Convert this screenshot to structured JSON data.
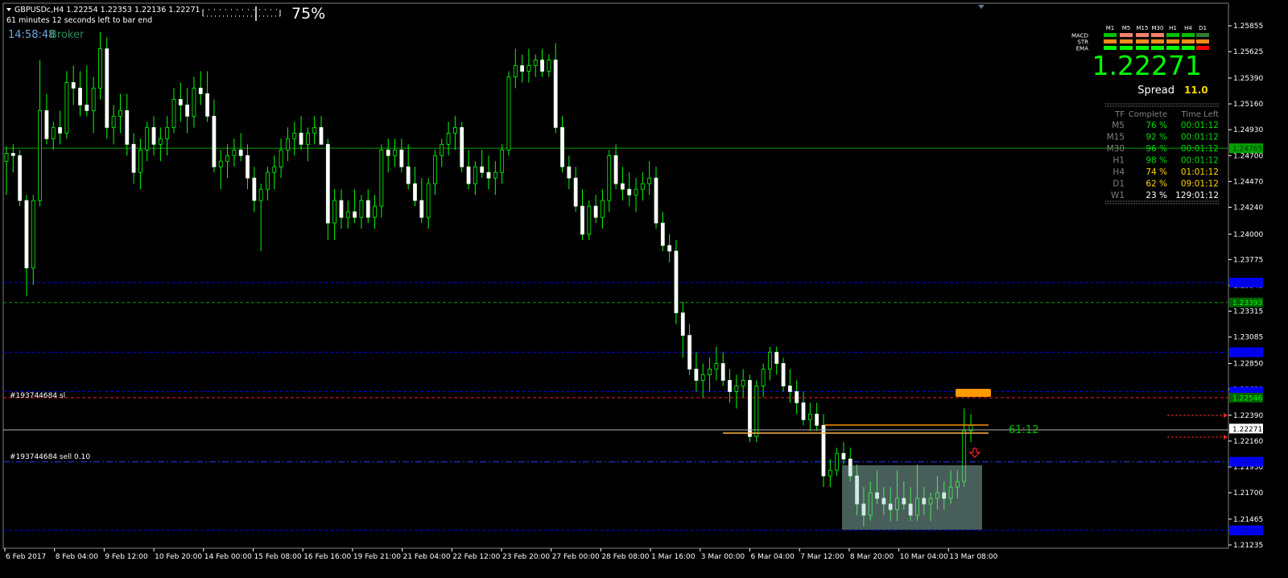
{
  "header": {
    "symbol_line": "GBPUSDc,H4  1.22254 1.22353 1.22136 1.22271",
    "timer_line": "61 minutes 12 seconds left to bar end",
    "clock": "14:58:48",
    "clock_suffix": "Broker",
    "progress_text": "75%"
  },
  "signal_panel": {
    "timeframes": [
      "M1",
      "M5",
      "M15",
      "M30",
      "H1",
      "H4",
      "D1"
    ],
    "rows": [
      {
        "label": "MACD",
        "colors": [
          "#00c000",
          "#f08070",
          "#f08070",
          "#f08070",
          "#00c000",
          "#00c000",
          "#2e7d32"
        ]
      },
      {
        "label": "STR",
        "colors": [
          "#ff8c1a",
          "#ff8c1a",
          "#ff8c1a",
          "#ff8c1a",
          "#ff8c1a",
          "#ff8c1a",
          "#ff8c1a"
        ]
      },
      {
        "label": "EMA",
        "colors": [
          "#00ff00",
          "#00ff00",
          "#00ff00",
          "#00ff00",
          "#00ff00",
          "#00ff00",
          "#ff0000"
        ]
      }
    ],
    "price": "1.22271",
    "spread_label": "Spread",
    "spread_value": "11.0"
  },
  "tf_table": {
    "headers": [
      "TF",
      "Complete",
      "Time Left"
    ],
    "rows": [
      {
        "tf": "M5",
        "complete": "76 %",
        "left": "00:01:12",
        "color": "#00dd00"
      },
      {
        "tf": "M15",
        "complete": "92 %",
        "left": "00:01:12",
        "color": "#00dd00"
      },
      {
        "tf": "M30",
        "complete": "96 %",
        "left": "00:01:12",
        "color": "#00dd00"
      },
      {
        "tf": "H1",
        "complete": "98 %",
        "left": "00:01:12",
        "color": "#00dd00"
      },
      {
        "tf": "H4",
        "complete": "74 %",
        "left": "01:01:12",
        "color": "#ffd700"
      },
      {
        "tf": "D1",
        "complete": "62 %",
        "left": "09:01:12",
        "color": "#ffd700"
      },
      {
        "tf": "W1",
        "complete": "23 %",
        "left": "129:01:12",
        "color": "#ffffff"
      }
    ]
  },
  "price_axis": {
    "labels": [
      "1.25855",
      "1.25625",
      "1.25390",
      "1.25160",
      "1.24930",
      "1.24700",
      "1.24470",
      "1.24240",
      "1.24000",
      "1.23775",
      "1.23545",
      "1.23315",
      "1.23085",
      "1.22850",
      "1.22620",
      "1.22390",
      "1.22160",
      "1.21930",
      "1.21700",
      "1.21465",
      "1.21235"
    ],
    "y_top": 1.25855,
    "y_bottom": 1.21235,
    "tags": [
      {
        "value": "1.24765",
        "price": 1.24765,
        "bg": "#00a000",
        "fg": "#003000"
      },
      {
        "value": "1.23570",
        "price": 1.2357,
        "bg": "#0000ff",
        "fg": "#0000aa"
      },
      {
        "value": "1.23393",
        "price": 1.23393,
        "bg": "#006000",
        "fg": "#00ff00"
      },
      {
        "value": "1.22950",
        "price": 1.2295,
        "bg": "#0000ff",
        "fg": "#0000aa"
      },
      {
        "value": "1.22600",
        "price": 1.226,
        "bg": "#0000ff",
        "fg": "#0000aa"
      },
      {
        "value": "1.22546",
        "price": 1.22546,
        "bg": "#006000",
        "fg": "#00ff00"
      },
      {
        "value": "1.22271",
        "price": 1.22271,
        "bg": "#ffffff",
        "fg": "#000000"
      },
      {
        "value": "1.21975",
        "price": 1.21975,
        "bg": "#0000ff",
        "fg": "#0000aa"
      },
      {
        "value": "1.21365",
        "price": 1.21365,
        "bg": "#0000ff",
        "fg": "#0000aa"
      }
    ]
  },
  "time_axis": {
    "labels": [
      "6 Feb 2017",
      "8 Feb 04:00",
      "9 Feb 12:00",
      "10 Feb 20:00",
      "14 Feb 00:00",
      "15 Feb 08:00",
      "16 Feb 16:00",
      "19 Feb 21:00",
      "21 Feb 04:00",
      "22 Feb 12:00",
      "23 Feb 20:00",
      "27 Feb 00:00",
      "28 Feb 08:00",
      "1 Mar 16:00",
      "3 Mar 00:00",
      "6 Mar 04:00",
      "7 Mar 12:00",
      "8 Mar 20:00",
      "10 Mar 04:00",
      "13 Mar 08:00"
    ]
  },
  "orders": {
    "sl_label": "#193744684 sl",
    "sell_label": "#193744684 sell 0.10",
    "countdown": "61:12"
  },
  "chart_data": {
    "type": "candlestick",
    "symbol": "GBPUSDc",
    "timeframe": "H4",
    "ylim": [
      1.21235,
      1.25855
    ],
    "current_price": 1.22271,
    "bid": 1.22271,
    "ask": 1.22382,
    "levels": [
      {
        "price": 1.24765,
        "style": "solid",
        "color": "#00a000"
      },
      {
        "price": 1.2357,
        "style": "dashed",
        "color": "#0000ff"
      },
      {
        "price": 1.23393,
        "style": "dashed",
        "color": "#00a000"
      },
      {
        "price": 1.2295,
        "style": "dashed",
        "color": "#0000ff"
      },
      {
        "price": 1.226,
        "style": "dashed",
        "color": "#0000ff"
      },
      {
        "price": 1.22546,
        "style": "dashed",
        "color": "#ff2020"
      },
      {
        "price": 1.21975,
        "style": "dashdot",
        "color": "#2040ff"
      },
      {
        "price": 1.21365,
        "style": "dashed",
        "color": "#0000ff"
      }
    ],
    "candles": [
      [
        1.2465,
        1.2478,
        1.2435,
        1.2472
      ],
      [
        1.2472,
        1.248,
        1.2455,
        1.247
      ],
      [
        1.247,
        1.2475,
        1.2425,
        1.243
      ],
      [
        1.243,
        1.2435,
        1.2345,
        1.237
      ],
      [
        1.237,
        1.2435,
        1.2355,
        1.243
      ],
      [
        1.243,
        1.2555,
        1.2425,
        1.251
      ],
      [
        1.251,
        1.2525,
        1.248,
        1.2485
      ],
      [
        1.2485,
        1.25,
        1.2475,
        1.2495
      ],
      [
        1.2495,
        1.251,
        1.248,
        1.249
      ],
      [
        1.249,
        1.2545,
        1.2485,
        1.2535
      ],
      [
        1.2535,
        1.255,
        1.2515,
        1.253
      ],
      [
        1.253,
        1.2545,
        1.2505,
        1.2515
      ],
      [
        1.2515,
        1.255,
        1.2505,
        1.251
      ],
      [
        1.251,
        1.254,
        1.249,
        1.253
      ],
      [
        1.253,
        1.258,
        1.252,
        1.2565
      ],
      [
        1.2565,
        1.2575,
        1.2485,
        1.2495
      ],
      [
        1.2495,
        1.2515,
        1.248,
        1.2505
      ],
      [
        1.2505,
        1.2525,
        1.249,
        1.251
      ],
      [
        1.251,
        1.2525,
        1.247,
        1.248
      ],
      [
        1.248,
        1.249,
        1.2445,
        1.2455
      ],
      [
        1.2455,
        1.2485,
        1.244,
        1.2475
      ],
      [
        1.2475,
        1.25,
        1.2465,
        1.2495
      ],
      [
        1.2495,
        1.2505,
        1.247,
        1.248
      ],
      [
        1.248,
        1.2495,
        1.2465,
        1.2485
      ],
      [
        1.2485,
        1.2505,
        1.247,
        1.2495
      ],
      [
        1.2495,
        1.253,
        1.249,
        1.252
      ],
      [
        1.252,
        1.2535,
        1.25,
        1.2515
      ],
      [
        1.2515,
        1.253,
        1.249,
        1.2505
      ],
      [
        1.2505,
        1.254,
        1.2495,
        1.253
      ],
      [
        1.253,
        1.2545,
        1.2515,
        1.2525
      ],
      [
        1.2525,
        1.2545,
        1.25,
        1.2505
      ],
      [
        1.2505,
        1.252,
        1.2455,
        1.246
      ],
      [
        1.246,
        1.2475,
        1.244,
        1.2465
      ],
      [
        1.2465,
        1.248,
        1.245,
        1.247
      ],
      [
        1.247,
        1.2485,
        1.246,
        1.2475
      ],
      [
        1.2475,
        1.249,
        1.2465,
        1.247
      ],
      [
        1.247,
        1.248,
        1.244,
        1.245
      ],
      [
        1.245,
        1.246,
        1.242,
        1.243
      ],
      [
        1.243,
        1.2445,
        1.2385,
        1.244
      ],
      [
        1.244,
        1.246,
        1.243,
        1.2455
      ],
      [
        1.2455,
        1.247,
        1.244,
        1.246
      ],
      [
        1.246,
        1.2485,
        1.245,
        1.2475
      ],
      [
        1.2475,
        1.2495,
        1.2465,
        1.2485
      ],
      [
        1.2485,
        1.25,
        1.247,
        1.249
      ],
      [
        1.249,
        1.2505,
        1.2475,
        1.248
      ],
      [
        1.248,
        1.2495,
        1.2465,
        1.249
      ],
      [
        1.249,
        1.2505,
        1.248,
        1.2495
      ],
      [
        1.2495,
        1.2505,
        1.248,
        1.248
      ],
      [
        1.248,
        1.2485,
        1.2395,
        1.241
      ],
      [
        1.241,
        1.244,
        1.2395,
        1.243
      ],
      [
        1.243,
        1.244,
        1.2405,
        1.2415
      ],
      [
        1.2415,
        1.243,
        1.2405,
        1.242
      ],
      [
        1.242,
        1.244,
        1.241,
        1.2415
      ],
      [
        1.2415,
        1.2435,
        1.2405,
        1.243
      ],
      [
        1.243,
        1.244,
        1.241,
        1.2415
      ],
      [
        1.2415,
        1.2435,
        1.2405,
        1.2425
      ],
      [
        1.2425,
        1.248,
        1.2415,
        1.2475
      ],
      [
        1.2475,
        1.2485,
        1.2455,
        1.247
      ],
      [
        1.247,
        1.2485,
        1.246,
        1.2475
      ],
      [
        1.2475,
        1.2485,
        1.2455,
        1.246
      ],
      [
        1.246,
        1.248,
        1.244,
        1.2445
      ],
      [
        1.2445,
        1.246,
        1.2425,
        1.243
      ],
      [
        1.243,
        1.245,
        1.241,
        1.2415
      ],
      [
        1.2415,
        1.245,
        1.2405,
        1.2445
      ],
      [
        1.2445,
        1.2475,
        1.2435,
        1.247
      ],
      [
        1.247,
        1.2485,
        1.246,
        1.248
      ],
      [
        1.248,
        1.25,
        1.247,
        1.249
      ],
      [
        1.249,
        1.2505,
        1.2475,
        1.2495
      ],
      [
        1.2495,
        1.25,
        1.2455,
        1.246
      ],
      [
        1.246,
        1.2475,
        1.244,
        1.2445
      ],
      [
        1.2445,
        1.2465,
        1.2435,
        1.246
      ],
      [
        1.246,
        1.2475,
        1.245,
        1.2455
      ],
      [
        1.2455,
        1.247,
        1.244,
        1.245
      ],
      [
        1.245,
        1.2465,
        1.2435,
        1.2455
      ],
      [
        1.2455,
        1.248,
        1.2445,
        1.2475
      ],
      [
        1.2475,
        1.2545,
        1.247,
        1.254
      ],
      [
        1.254,
        1.2565,
        1.253,
        1.255
      ],
      [
        1.255,
        1.256,
        1.2535,
        1.2545
      ],
      [
        1.2545,
        1.2565,
        1.2535,
        1.255
      ],
      [
        1.255,
        1.256,
        1.254,
        1.2555
      ],
      [
        1.2555,
        1.2565,
        1.254,
        1.2545
      ],
      [
        1.2545,
        1.256,
        1.254,
        1.2555
      ],
      [
        1.2555,
        1.257,
        1.249,
        1.2495
      ],
      [
        1.2495,
        1.2505,
        1.2455,
        1.246
      ],
      [
        1.246,
        1.247,
        1.244,
        1.245
      ],
      [
        1.245,
        1.246,
        1.242,
        1.2425
      ],
      [
        1.2425,
        1.244,
        1.2395,
        1.24
      ],
      [
        1.24,
        1.243,
        1.2395,
        1.2425
      ],
      [
        1.2425,
        1.2435,
        1.241,
        1.2415
      ],
      [
        1.2415,
        1.244,
        1.2405,
        1.243
      ],
      [
        1.243,
        1.2475,
        1.242,
        1.247
      ],
      [
        1.247,
        1.248,
        1.244,
        1.2445
      ],
      [
        1.2445,
        1.246,
        1.243,
        1.244
      ],
      [
        1.244,
        1.2455,
        1.2425,
        1.2435
      ],
      [
        1.2435,
        1.245,
        1.242,
        1.244
      ],
      [
        1.244,
        1.2455,
        1.243,
        1.2445
      ],
      [
        1.2445,
        1.2465,
        1.2435,
        1.245
      ],
      [
        1.245,
        1.246,
        1.2405,
        1.241
      ],
      [
        1.241,
        1.242,
        1.2385,
        1.239
      ],
      [
        1.239,
        1.24,
        1.2375,
        1.2385
      ],
      [
        1.2385,
        1.2395,
        1.232,
        1.233
      ],
      [
        1.233,
        1.234,
        1.229,
        1.231
      ],
      [
        1.231,
        1.232,
        1.2275,
        1.228
      ],
      [
        1.228,
        1.2295,
        1.226,
        1.227
      ],
      [
        1.227,
        1.2285,
        1.2255,
        1.2275
      ],
      [
        1.2275,
        1.229,
        1.226,
        1.228
      ],
      [
        1.228,
        1.23,
        1.227,
        1.2285
      ],
      [
        1.2285,
        1.2295,
        1.2265,
        1.227
      ],
      [
        1.227,
        1.228,
        1.225,
        1.226
      ],
      [
        1.226,
        1.2275,
        1.2245,
        1.2265
      ],
      [
        1.2265,
        1.228,
        1.2255,
        1.227
      ],
      [
        1.227,
        1.2275,
        1.2215,
        1.222
      ],
      [
        1.222,
        1.227,
        1.2215,
        1.2265
      ],
      [
        1.2265,
        1.2285,
        1.2255,
        1.228
      ],
      [
        1.228,
        1.23,
        1.227,
        1.2295
      ],
      [
        1.2295,
        1.23,
        1.2275,
        1.2285
      ],
      [
        1.2285,
        1.229,
        1.226,
        1.2265
      ],
      [
        1.2265,
        1.228,
        1.225,
        1.226
      ],
      [
        1.226,
        1.227,
        1.224,
        1.225
      ],
      [
        1.225,
        1.226,
        1.223,
        1.2235
      ],
      [
        1.2235,
        1.225,
        1.2225,
        1.224
      ],
      [
        1.224,
        1.225,
        1.2225,
        1.223
      ],
      [
        1.223,
        1.224,
        1.2175,
        1.2185
      ],
      [
        1.2185,
        1.22,
        1.2175,
        1.219
      ],
      [
        1.219,
        1.221,
        1.2185,
        1.2205
      ],
      [
        1.2205,
        1.2215,
        1.2195,
        1.22
      ],
      [
        1.22,
        1.221,
        1.218,
        1.2185
      ],
      [
        1.2185,
        1.2195,
        1.215,
        1.216
      ],
      [
        1.216,
        1.2175,
        1.214,
        1.215
      ],
      [
        1.215,
        1.218,
        1.2145,
        1.217
      ],
      [
        1.217,
        1.219,
        1.216,
        1.2165
      ],
      [
        1.2165,
        1.2175,
        1.215,
        1.216
      ],
      [
        1.216,
        1.2175,
        1.2145,
        1.2155
      ],
      [
        1.2155,
        1.219,
        1.2145,
        1.2165
      ],
      [
        1.2165,
        1.218,
        1.2155,
        1.216
      ],
      [
        1.216,
        1.2175,
        1.2145,
        1.215
      ],
      [
        1.215,
        1.2195,
        1.2145,
        1.2165
      ],
      [
        1.2165,
        1.2175,
        1.215,
        1.216
      ],
      [
        1.216,
        1.217,
        1.2145,
        1.2165
      ],
      [
        1.2165,
        1.2185,
        1.2155,
        1.217
      ],
      [
        1.217,
        1.218,
        1.2155,
        1.2165
      ],
      [
        1.2165,
        1.219,
        1.216,
        1.2175
      ],
      [
        1.2175,
        1.219,
        1.2165,
        1.218
      ],
      [
        1.218,
        1.2245,
        1.2175,
        1.2225
      ],
      [
        1.2225,
        1.224,
        1.2215,
        1.223
      ]
    ]
  }
}
